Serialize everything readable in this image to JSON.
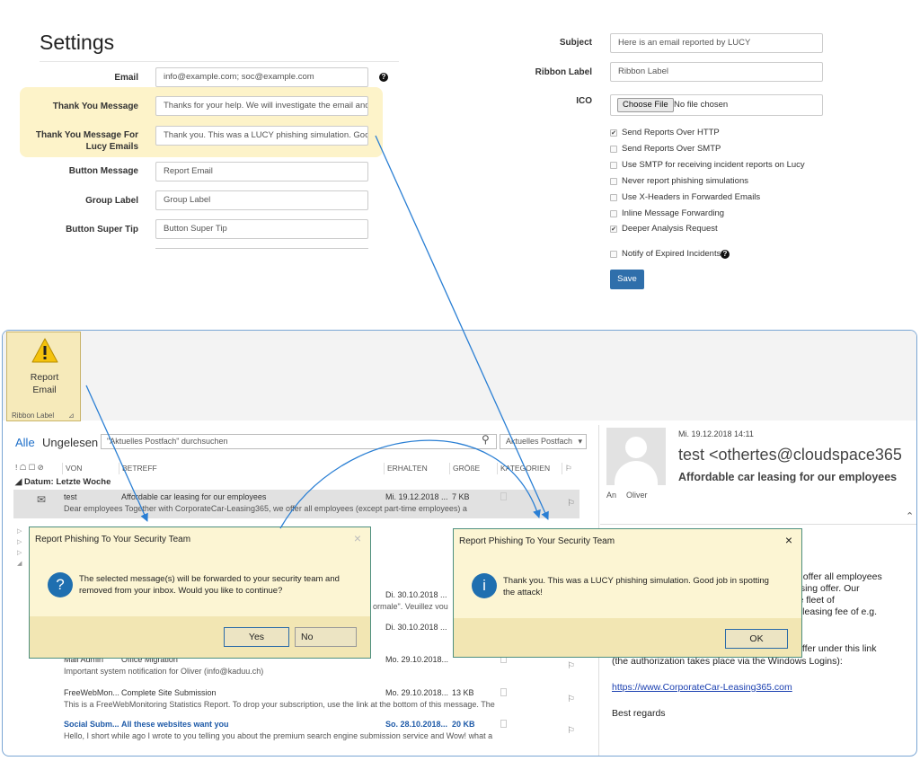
{
  "settings": {
    "title": "Settings",
    "fields": [
      {
        "label": "Email",
        "value": "info@example.com; soc@example.com"
      },
      {
        "label": "Thank You Message",
        "value": "Thanks for your help. We will investigate the email and"
      },
      {
        "label": "Thank You Message For Lucy Emails",
        "value": "Thank you. This was a LUCY phishing simulation. Goo"
      },
      {
        "label": "Button Message",
        "value": "Report Email"
      },
      {
        "label": "Group Label",
        "value": "Group Label"
      },
      {
        "label": "Button Super Tip",
        "value": "Button Super Tip"
      }
    ],
    "subject_label": "Subject",
    "subject_value": "Here is an email reported by LUCY",
    "ribbon_label_label": "Ribbon Label",
    "ribbon_label_value": "Ribbon Label",
    "ico_label": "ICO",
    "choose_file": "Choose File",
    "no_file": "No file chosen",
    "checkboxes": [
      {
        "label": "Send Reports Over HTTP",
        "checked": true
      },
      {
        "label": "Send Reports Over SMTP",
        "checked": false
      },
      {
        "label": "Use SMTP for receiving incident reports on Lucy",
        "checked": false
      },
      {
        "label": "Never report phishing simulations",
        "checked": false
      },
      {
        "label": "Use X-Headers in Forwarded Emails",
        "checked": false
      },
      {
        "label": "Inline Message Forwarding",
        "checked": false
      },
      {
        "label": "Deeper Analysis Request",
        "checked": true
      },
      {
        "label": "Notify of Expired Incidents",
        "checked": false
      }
    ],
    "save": "Save"
  },
  "outlook": {
    "report_button": [
      "Report",
      "Email"
    ],
    "ribbon_label": "Ribbon Label",
    "nav_all": "Alle",
    "nav_unread": "Ungelesen",
    "search_placeholder": "\"Aktuelles Postfach\" durchsuchen",
    "search_scope": "Aktuelles Postfach",
    "columns": [
      "VON",
      "BETREFF",
      "ERHALTEN",
      "GRÖßE",
      "KATEGORIEN"
    ],
    "group": "Datum: Letzte Woche",
    "mails": [
      {
        "from": "test",
        "subject": "Affordable car leasing for our employees",
        "date": "Mi. 19.12.2018 ...",
        "size": "7 KB",
        "preview": "Dear employees  Together with CorporateCar-Leasing365, we offer all employees (except part-time employees) a"
      },
      {
        "from": "",
        "subject": "",
        "date": "Di. 30.10.2018 ...",
        "size": "",
        "preview": "ormale\". Veuillez vou"
      },
      {
        "from": "",
        "subject": "",
        "date": "Di. 30.10.2018 ...",
        "size": "",
        "preview": ""
      },
      {
        "from": "Mail Admin",
        "subject": "Office Migration",
        "date": "Mo. 29.10.2018...",
        "size": "",
        "preview": "Important system notification for Oliver (info@kaduu.ch)"
      },
      {
        "from": "FreeWebMon...",
        "subject": "Complete Site Submission",
        "date": "Mo. 29.10.2018...",
        "size": "13 KB",
        "preview": "This is a FreeWebMonitoring Statistics Report.  To drop your subscription, use the link at the bottom of this message.  The"
      },
      {
        "from": "Social Subm...",
        "subject": "All these websites want you",
        "date": "So. 28.10.2018...",
        "size": "20 KB",
        "preview": "Hello,  I short while ago I wrote to you telling you about the premium search engine  submission service and Wow! what a"
      }
    ],
    "reading": {
      "date": "Mi. 19.12.2018 14:11",
      "sender": "test <othertes@cloudspace365",
      "subject": "Affordable car leasing for our employees",
      "to_label": "An",
      "to": "Oliver",
      "body": [
        "e offer all employees",
        "asing offer. Our",
        "re fleet of",
        "y leasing fee of e.g."
      ],
      "body2": "offer under this link",
      "body3": "(the authorization takes place via the Windows Logins):",
      "link": "https://www.CorporateCar-Leasing365.com",
      "regards": "Best regards"
    }
  },
  "dialog_confirm": {
    "title": "Report Phishing To Your Security Team",
    "text": [
      "The selected message(s) will be forwarded to your security team and",
      "removed from your inbox. Would you like to continue?"
    ],
    "yes": "Yes",
    "no": "No"
  },
  "dialog_info": {
    "title": "Report Phishing To Your Security Team",
    "text": [
      "Thank you. This was a LUCY phishing simulation. Good job in spotting",
      "the attack!"
    ],
    "ok": "OK"
  }
}
